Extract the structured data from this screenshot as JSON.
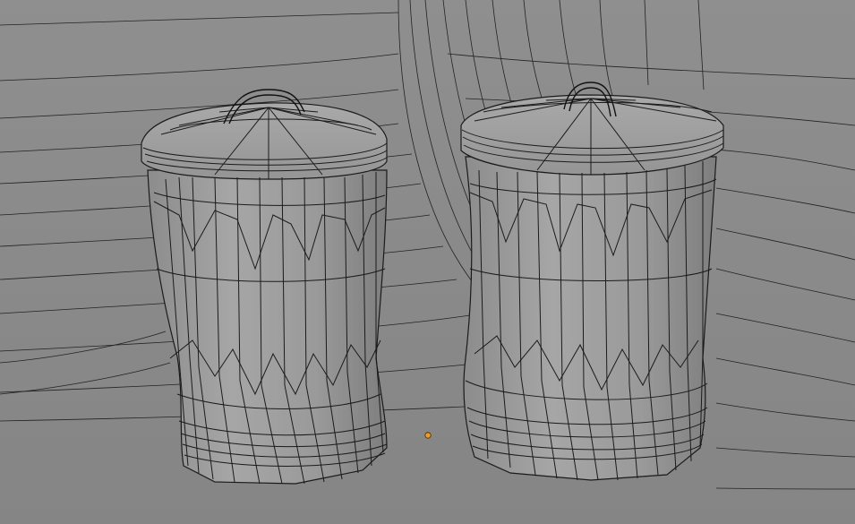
{
  "viewport": {
    "mode": "3d-edit-wireframe",
    "background": "#8a8a8a",
    "mesh_fill": "#9c9c9c",
    "wire_color": "#1b1b1b",
    "origin_marker_color": "#f39b1e"
  },
  "scene": {
    "objects": [
      {
        "name": "trash-can-left",
        "type": "mesh"
      },
      {
        "name": "trash-can-right",
        "type": "mesh"
      },
      {
        "name": "backdrop-floor",
        "type": "mesh"
      }
    ],
    "active_origin_visible": true
  }
}
